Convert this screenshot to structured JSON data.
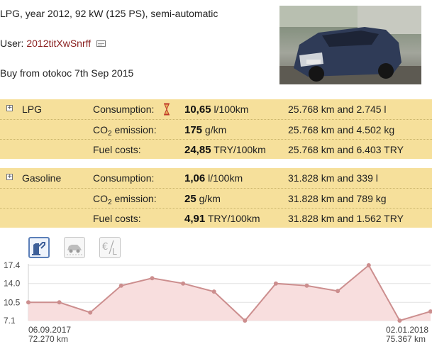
{
  "vehicle": {
    "spec_line": "LPG, year 2012, 92 kW (125 PS), semi-automatic",
    "user_label": "User:",
    "user_name": "2012titXwSnrff",
    "purchase_line": "Buy from otokoc 7th Sep 2015"
  },
  "fuels": [
    {
      "name": "LPG",
      "rows": [
        {
          "label": "Consumption:",
          "value": "10,65",
          "unit": "l/100km",
          "totals": "25.768 km and 2.745 l"
        },
        {
          "label_pre": "CO",
          "label_sub": "2",
          "label_post": " emission:",
          "value": "175",
          "unit": "g/km",
          "totals": "25.768 km and 4.502 kg"
        },
        {
          "label": "Fuel costs:",
          "value": "24,85",
          "unit": "TRY/100km",
          "totals": "25.768 km and 6.403 TRY"
        }
      ]
    },
    {
      "name": "Gasoline",
      "rows": [
        {
          "label": "Consumption:",
          "value": "1,06",
          "unit": "l/100km",
          "totals": "31.828 km and 339 l"
        },
        {
          "label_pre": "CO",
          "label_sub": "2",
          "label_post": " emission:",
          "value": "25",
          "unit": "g/km",
          "totals": "31.828 km and 789 kg"
        },
        {
          "label": "Fuel costs:",
          "value": "4,91",
          "unit": "TRY/100km",
          "totals": "31.828 km and 1.562 TRY"
        }
      ]
    }
  ],
  "chart_tabs": [
    {
      "icon": "fuel-pump-icon",
      "active": true
    },
    {
      "icon": "car-icon",
      "active": false
    },
    {
      "icon": "euro-per-liter-icon",
      "active": false
    }
  ],
  "chart_data": {
    "type": "area",
    "y_ticks": [
      "17.4",
      "14.0",
      "10.5",
      "7.1"
    ],
    "ylim": [
      7.1,
      17.4
    ],
    "values": [
      10.5,
      10.5,
      8.6,
      13.6,
      15.0,
      14.0,
      12.5,
      7.1,
      14.0,
      13.6,
      12.6,
      17.4,
      7.1,
      8.8
    ],
    "x_start_date": "06.09.2017",
    "x_start_km": "72.270 km",
    "x_end_date": "02.01.2018",
    "x_end_km": "75.367 km",
    "grid": true,
    "line_color": "#cc8e8e",
    "fill_color": "#f8dede"
  }
}
